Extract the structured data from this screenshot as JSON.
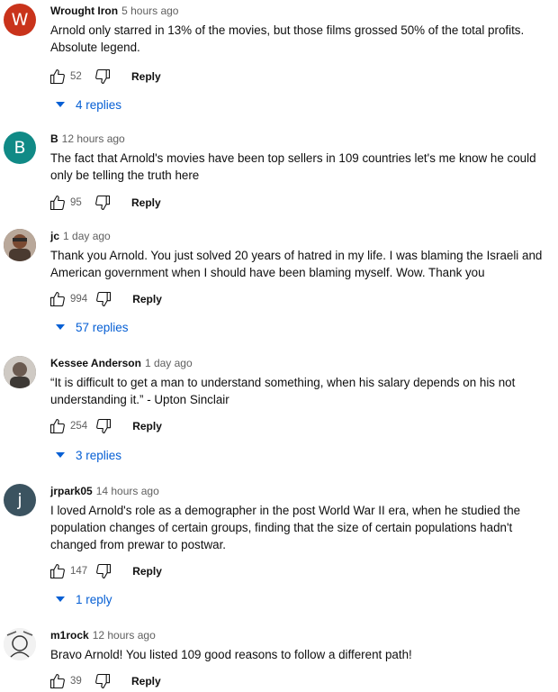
{
  "comments": [
    {
      "avatar_letter": "W",
      "avatar_color": "#c9331b",
      "author": "Wrought Iron",
      "time": "5 hours ago",
      "text": "Arnold only starred in 13% of the movies, but those films grossed 50% of the total profits. Absolute legend.",
      "likes": "52",
      "reply_label": "Reply",
      "replies_label": "4 replies"
    },
    {
      "avatar_letter": "B",
      "avatar_color": "#108a86",
      "author": "B",
      "time": "12 hours ago",
      "text": "The fact that Arnold's movies have been top sellers in 109 countries let's me know he could only be telling the truth here",
      "likes": "95",
      "reply_label": "Reply",
      "replies_label": ""
    },
    {
      "avatar_letter": "",
      "avatar_color": "#6b4a3a",
      "author": "jc",
      "time": "1 day ago",
      "text": "Thank you Arnold. You just solved 20 years of hatred in my life. I was blaming the Israeli and American government when I should have been blaming myself. Wow. Thank you",
      "likes": "994",
      "reply_label": "Reply",
      "replies_label": "57 replies"
    },
    {
      "avatar_letter": "",
      "avatar_color": "#5f5a55",
      "author": "Kessee Anderson",
      "time": "1 day ago",
      "text": "“It is difficult to get a man to understand something, when his salary depends on his not understanding it.” - Upton Sinclair",
      "likes": "254",
      "reply_label": "Reply",
      "replies_label": "3 replies"
    },
    {
      "avatar_letter": "j",
      "avatar_color": "#3b5360",
      "author": "jrpark05",
      "time": "14 hours ago",
      "text": "I loved Arnold's role as a demographer in the post World War II era, when he studied the population changes of certain groups, finding that the size of certain populations hadn't changed from prewar to postwar.",
      "likes": "147",
      "reply_label": "Reply",
      "replies_label": "1 reply"
    },
    {
      "avatar_letter": "",
      "avatar_color": "#e9e9e9",
      "author": "m1rock",
      "time": "12 hours ago",
      "text": "Bravo Arnold!  You listed 109 good reasons to follow a different path!",
      "likes": "39",
      "reply_label": "Reply",
      "replies_label": ""
    }
  ]
}
